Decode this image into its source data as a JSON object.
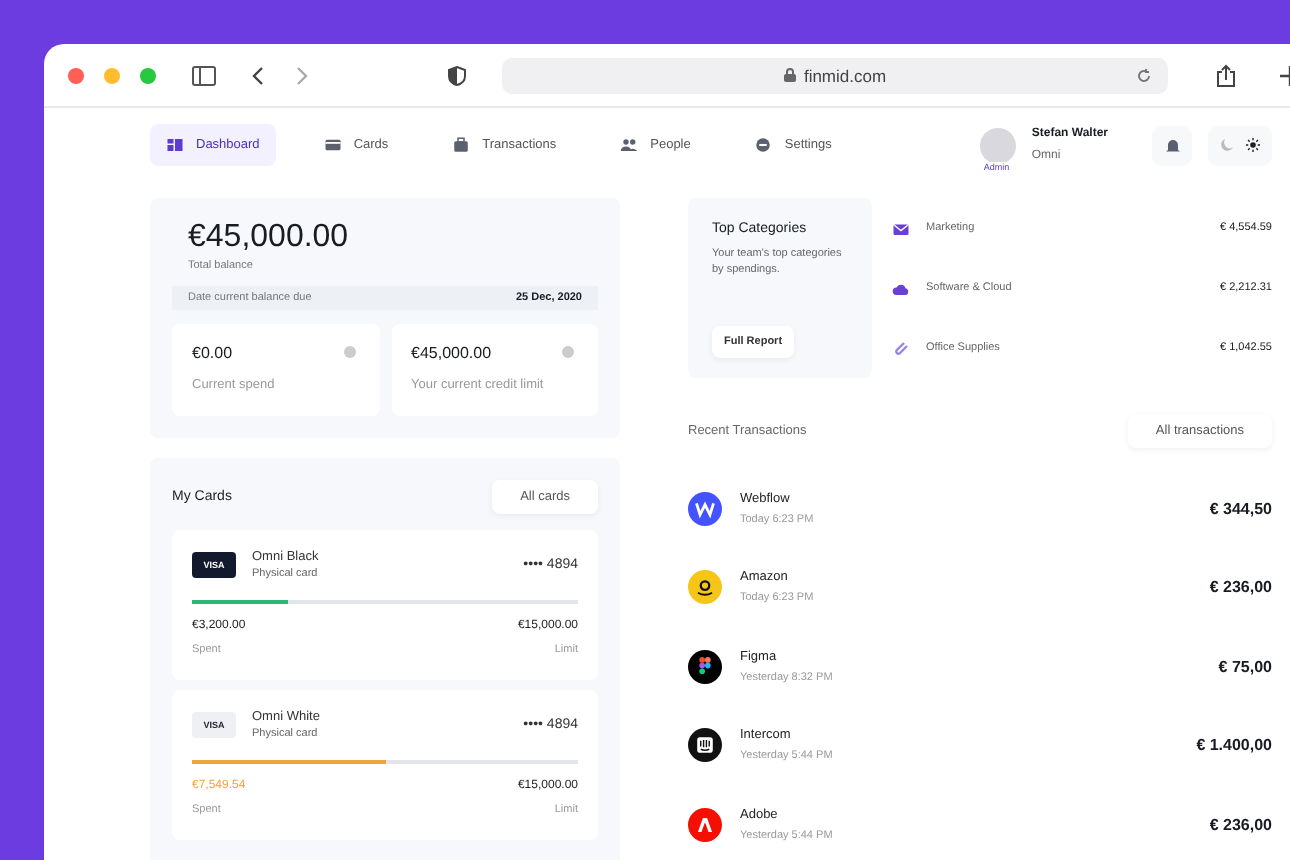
{
  "browser": {
    "url": "finmid.com"
  },
  "nav": [
    {
      "label": "Dashboard",
      "kind": "dashboard",
      "selected": true
    },
    {
      "label": "Cards",
      "kind": "card",
      "selected": false
    },
    {
      "label": "Transactions",
      "kind": "bag",
      "selected": false
    },
    {
      "label": "People",
      "kind": "people",
      "selected": false
    },
    {
      "label": "Settings",
      "kind": "settings",
      "selected": false
    }
  ],
  "user": {
    "name": "Stefan Walter",
    "company": "Omni",
    "role": "Admin"
  },
  "theme_toggle": [
    {
      "kind": "moon",
      "selected": false
    },
    {
      "kind": "sun",
      "selected": true
    }
  ],
  "balance": {
    "amount": "€45,000.00",
    "label": "Total balance",
    "due_label": "Date current balance due",
    "due_date": "25 Dec, 2020",
    "stats": [
      {
        "value": "€0.00",
        "label": "Current spend"
      },
      {
        "value": "€45,000.00",
        "label": "Your current credit limit"
      }
    ]
  },
  "my_cards": {
    "title": "My Cards",
    "button": "All cards",
    "cards": [
      {
        "name": "Omni Black",
        "type": "Physical card",
        "brand": "VISA",
        "kind": "dark",
        "number": "•••• 4894",
        "level": 0.25,
        "color": "#2bb673",
        "warning": false,
        "spent": "€3,200.00",
        "spent_label": "Spent",
        "limit": "€15,000.00",
        "limit_label": "Limit"
      },
      {
        "name": "Omni White",
        "type": "Physical card",
        "brand": "VISA",
        "kind": "light",
        "number": "•••• 4894",
        "level": 0.5,
        "color": "#f2a33a",
        "warning": true,
        "spent": "€7,549.54",
        "spent_label": "Spent",
        "limit": "€15,000.00",
        "limit_label": "Limit"
      }
    ]
  },
  "top_categories": {
    "title": "Top Categories",
    "description": "Your team's top categories by spendings.",
    "button": "Full Report",
    "items": [
      {
        "name": "Marketing",
        "kind": "mail",
        "amount": "€ 4,554.59"
      },
      {
        "name": "Software & Cloud",
        "kind": "cloud",
        "amount": "€ 2,212.31"
      },
      {
        "name": "Office Supplies",
        "kind": "clip",
        "amount": "€ 1,042.55"
      }
    ]
  },
  "recent_transactions": {
    "title": "Recent Transactions",
    "button": "All transactions",
    "rows": [
      {
        "merchant": "Webflow",
        "time": "Today 6:23 PM",
        "amount": "€ 344,50",
        "kind": "webflow",
        "color": "#4353ff"
      },
      {
        "merchant": "Amazon",
        "time": "Today 6:23 PM",
        "amount": "€ 236,00",
        "kind": "amazon",
        "color": "#f5c518"
      },
      {
        "merchant": "Figma",
        "time": "Yesterday 8:32 PM",
        "amount": "€ 75,00",
        "kind": "figma",
        "color": "#000000"
      },
      {
        "merchant": "Intercom",
        "time": "Yesterday 5:44 PM",
        "amount": "€ 1.400,00",
        "kind": "intercom",
        "color": "#111111"
      },
      {
        "merchant": "Adobe",
        "time": "Yesterday 5:44 PM",
        "amount": "€ 236,00",
        "kind": "adobe",
        "color": "#f40f02"
      }
    ]
  }
}
